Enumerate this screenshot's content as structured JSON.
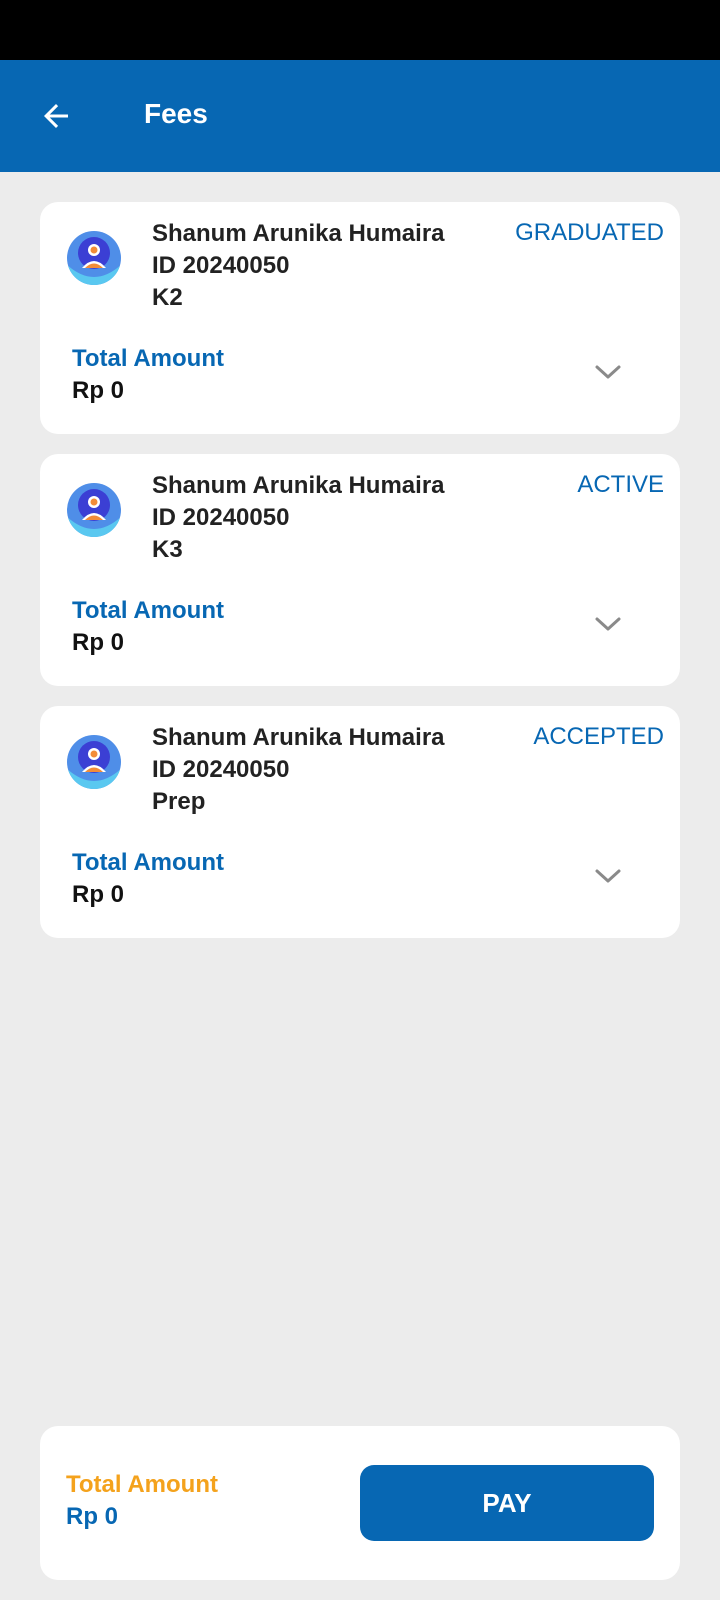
{
  "header": {
    "title": "Fees",
    "back_icon": "arrow-left-icon"
  },
  "colors": {
    "primary": "#0767b3",
    "accent_orange": "#f4a21c",
    "background": "#ececec"
  },
  "students": [
    {
      "name": "Shanum Arunika Humaira",
      "id": "ID 20240050",
      "grade": "K2",
      "status": "GRADUATED",
      "amount_label": "Total Amount",
      "amount": "Rp 0"
    },
    {
      "name": "Shanum Arunika Humaira",
      "id": "ID 20240050",
      "grade": "K3",
      "status": "ACTIVE",
      "amount_label": "Total Amount",
      "amount": "Rp 0"
    },
    {
      "name": "Shanum Arunika Humaira",
      "id": "ID 20240050",
      "grade": "Prep",
      "status": "ACCEPTED",
      "amount_label": "Total Amount",
      "amount": "Rp 0"
    }
  ],
  "footer": {
    "total_label": "Total Amount",
    "total_value": "Rp 0",
    "pay_label": "PAY"
  }
}
